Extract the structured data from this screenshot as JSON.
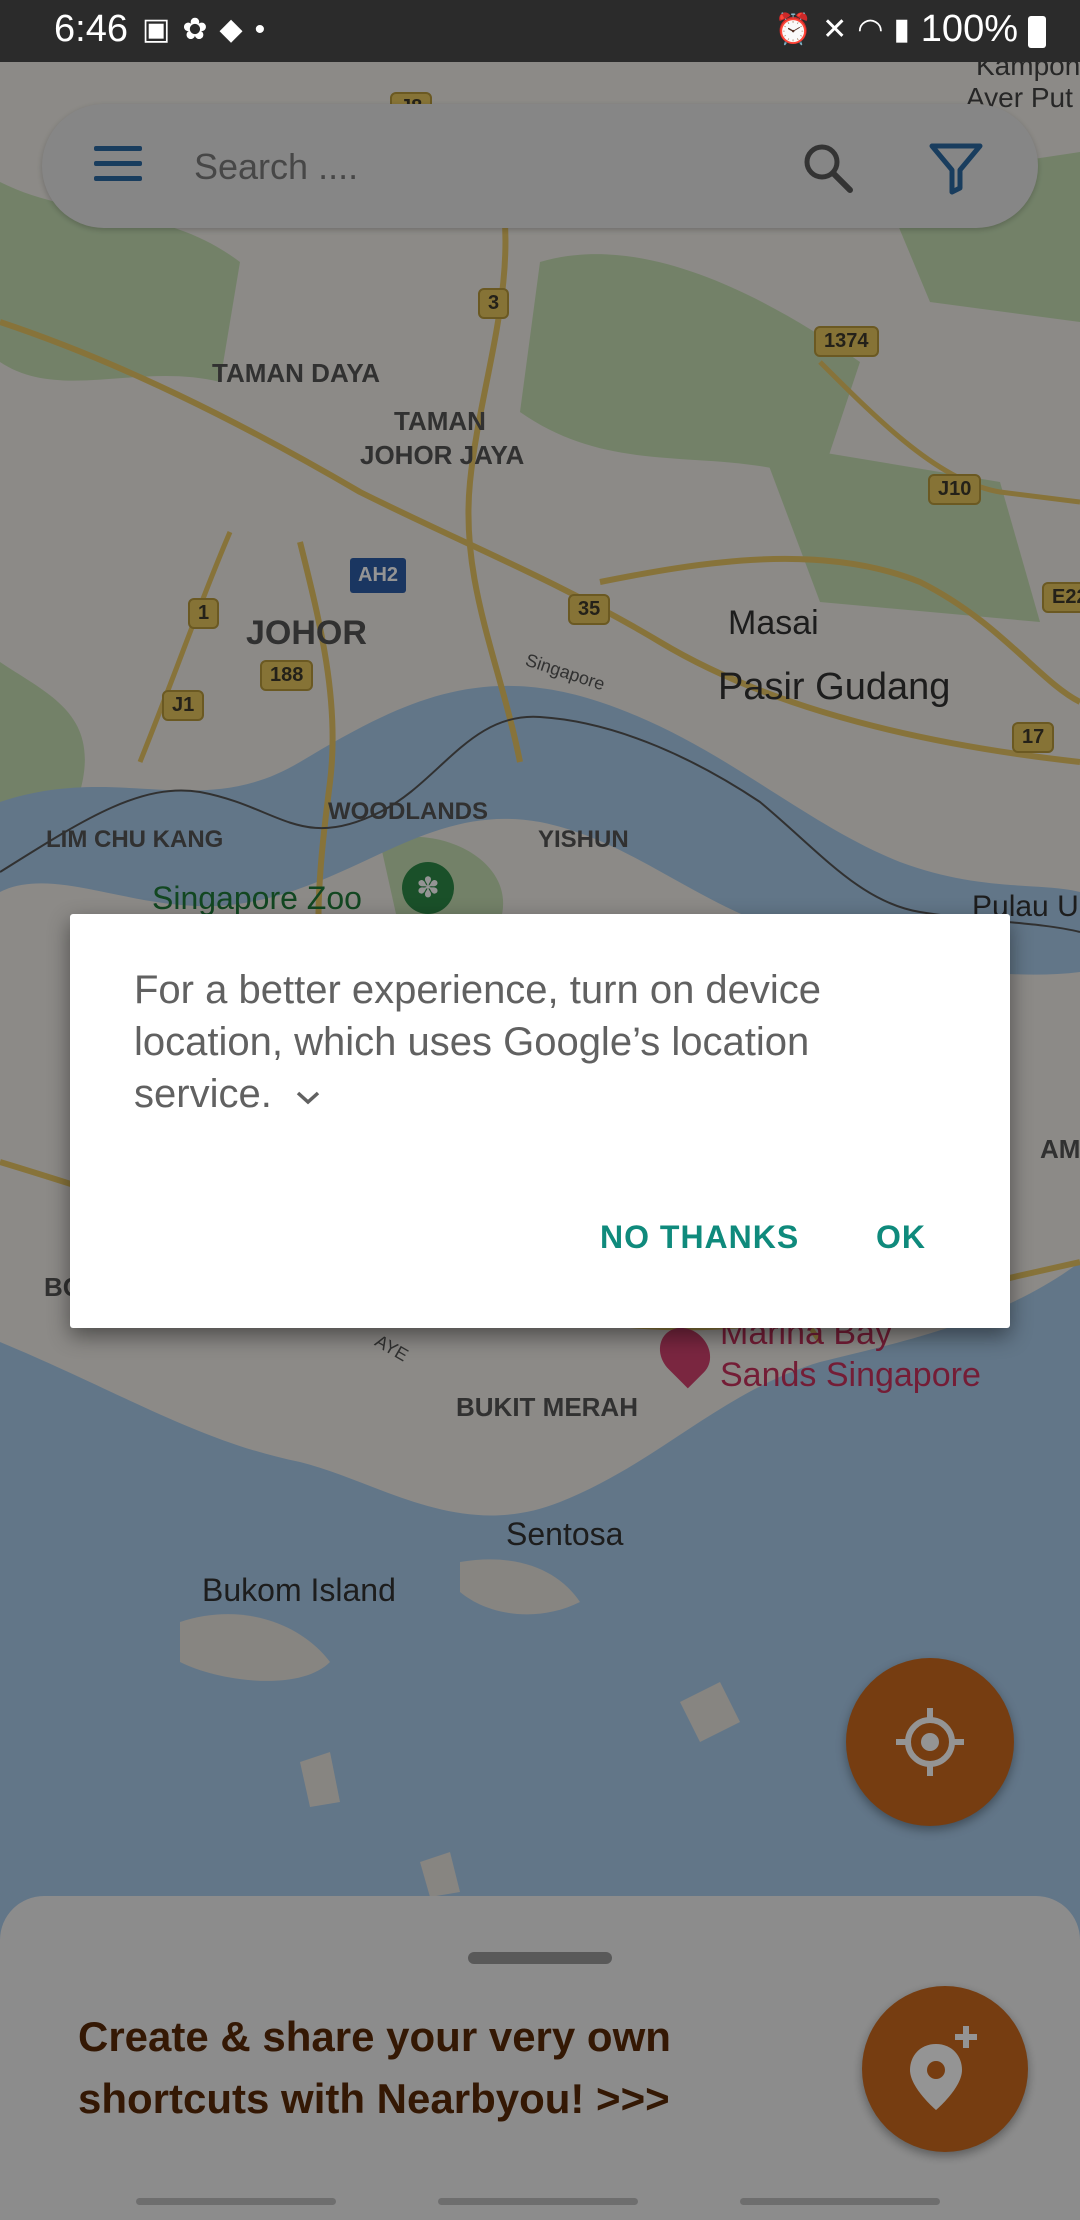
{
  "status_bar": {
    "time": "6:46",
    "battery": "100%",
    "left_icons": [
      "image-icon",
      "bug-icon",
      "shopping-bag-icon",
      "dot-icon"
    ],
    "right_icons": [
      "alarm-icon",
      "mute-icon",
      "wifi-icon",
      "signal-icon"
    ]
  },
  "search": {
    "placeholder": "Search ...."
  },
  "map": {
    "labels": {
      "kampong_ayer": "Kampon",
      "ayer_puteh": "Ayer Put",
      "taman_daya": "TAMAN DAYA",
      "taman": "TAMAN",
      "johor_jaya": "JOHOR JAYA",
      "johor": "JOHOR",
      "masai": "Masai",
      "pasir_gudang": "Pasir Gudang",
      "singapore_river": "Singapore",
      "woodlands": "WOODLANDS",
      "yishun": "YISHUN",
      "lim_chu_kang": "LIM CHU KANG",
      "singapore_zoo": "Singapore Zoo",
      "pulau": "Pulau U",
      "tampines": "AMPIN",
      "bo": "BO",
      "aye": "AYE",
      "marina_bay_1": "Marina Bay",
      "marina_bay_2": "Sands Singapore",
      "bukit_merah": "BUKIT MERAH",
      "sentosa": "Sentosa",
      "bukom": "Bukom Island"
    },
    "shields": {
      "j8": "J8",
      "r3": "3",
      "r1374": "1374",
      "j10": "J10",
      "ah2": "AH2",
      "r1": "1",
      "r35": "35",
      "e22": "E22",
      "r188": "188",
      "j1": "J1",
      "r17": "17"
    }
  },
  "dialog": {
    "message": "For a better experience, turn on device location, which uses Google’s location service.",
    "no_thanks": "NO THANKS",
    "ok": "OK"
  },
  "bottom_sheet": {
    "promo_text": "Create & share your very own shortcuts with Nearbyou! >>>"
  },
  "colors": {
    "accent_orange": "#cc6a1e",
    "dialog_button": "#0f8a7c",
    "promo_text": "#5a2a07",
    "menu_icon": "#2c6aa3"
  }
}
